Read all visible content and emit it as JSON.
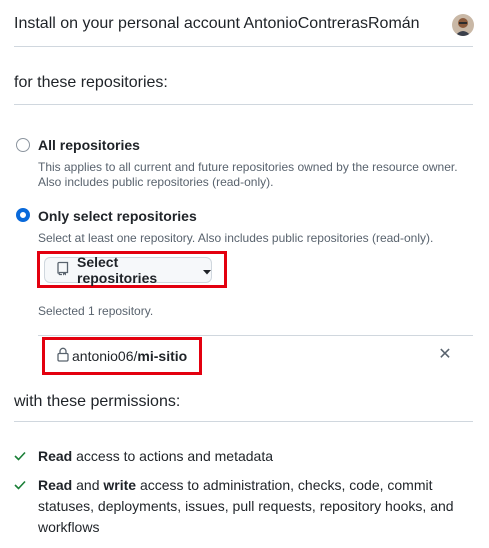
{
  "header": {
    "title": "Install on your personal account AntonioContrerasRomán"
  },
  "repos_section": {
    "title": "for these repositories:"
  },
  "options": {
    "all": {
      "label": "All repositories",
      "desc1": "This applies to all current and future repositories owned by the resource owner.",
      "desc2": "Also includes public repositories (read-only)."
    },
    "select": {
      "label": "Only select repositories",
      "desc": "Select at least one repository. Also includes public repositories (read-only)."
    }
  },
  "select_button": {
    "label": "Select repositories"
  },
  "selected": {
    "count_text": "Selected 1 repository.",
    "repo_owner": "antonio06/",
    "repo_name": "mi-sitio"
  },
  "permissions_section": {
    "title": "with these permissions:"
  },
  "permissions": [
    {
      "verb": "Read",
      "rest": " access to actions and metadata"
    },
    {
      "verb1": "Read",
      "and": " and ",
      "verb2": "write",
      "rest": " access to administration, checks, code, commit statuses, deployments, issues, pull requests, repository hooks, and workflows"
    }
  ],
  "colors": {
    "accent": "#0969da",
    "highlight": "#e3000f",
    "success": "#1a7f37"
  },
  "icons": [
    "avatar",
    "repo-icon",
    "caret-down-icon",
    "lock-icon",
    "close-icon",
    "check-icon"
  ]
}
